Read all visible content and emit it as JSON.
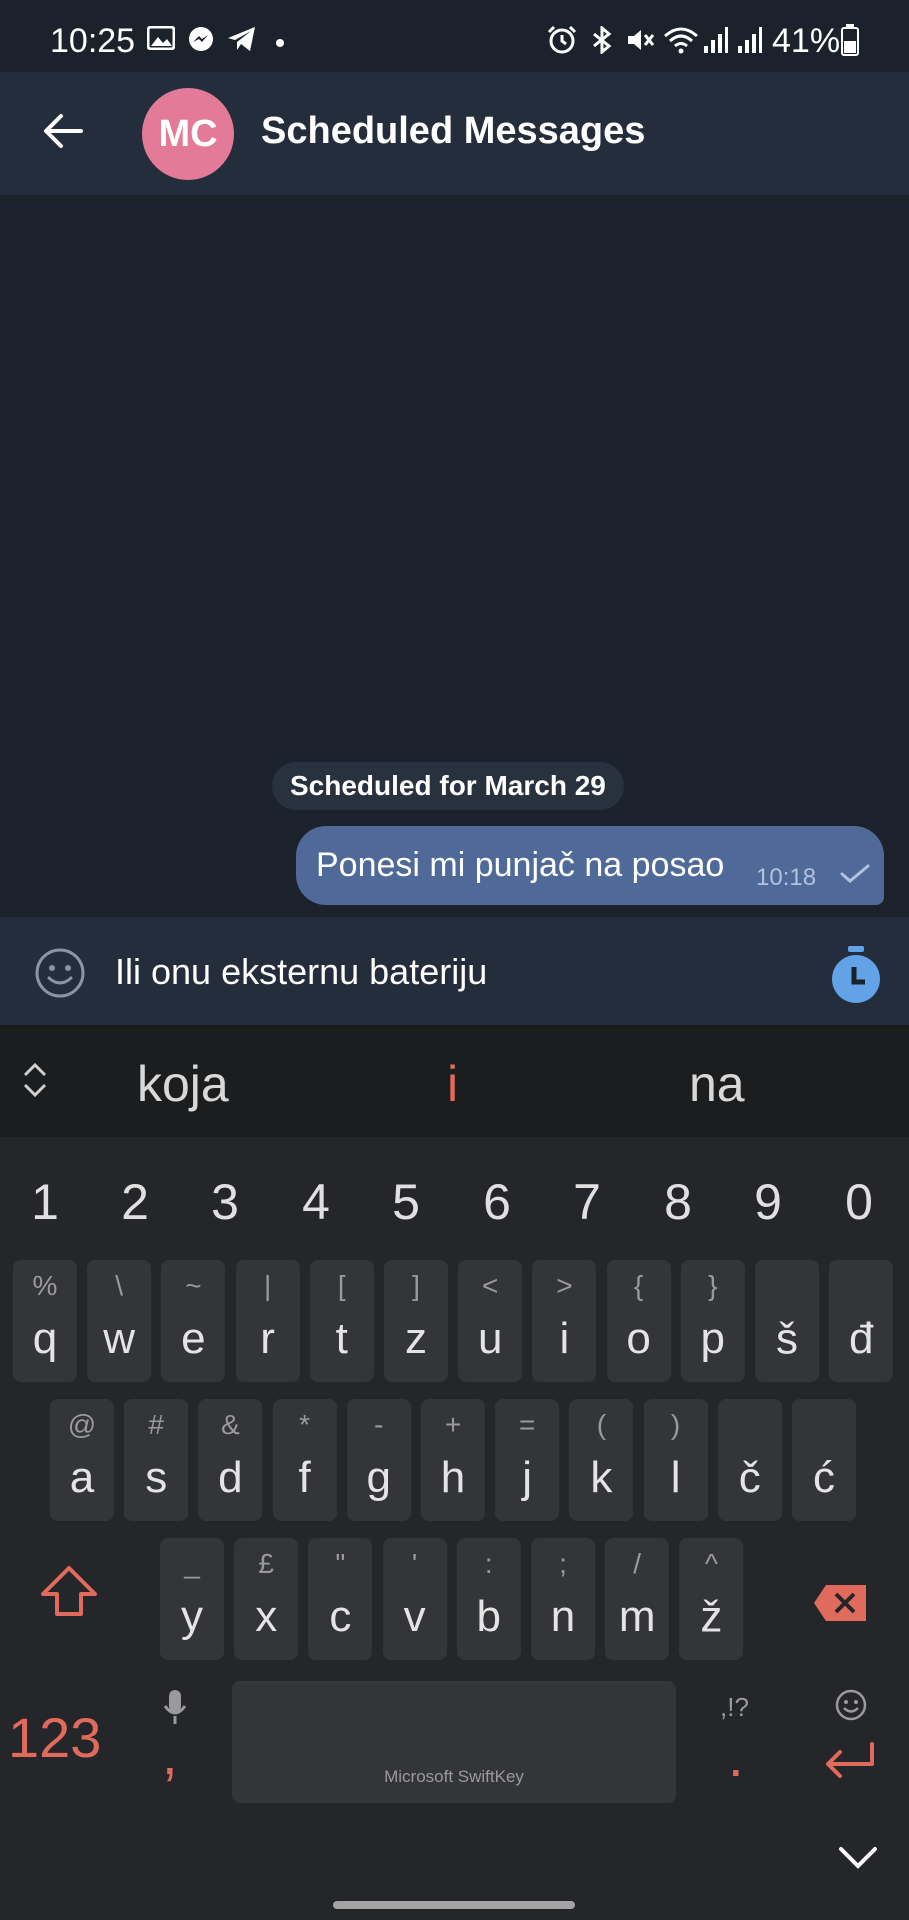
{
  "status_bar": {
    "time": "10:25",
    "battery": "41%",
    "icons": [
      "gallery-icon",
      "messenger-icon",
      "telegram-icon",
      "dot-icon",
      "alarm-icon",
      "bluetooth-icon",
      "mute-icon",
      "wifi-icon",
      "signal-icon",
      "signal-icon",
      "battery-icon"
    ]
  },
  "header": {
    "avatar_initials": "MC",
    "avatar_color": "#e27a98",
    "title": "Scheduled Messages"
  },
  "chat": {
    "date_chip": "Scheduled for March 29",
    "message": {
      "text": "Ponesi mi punjač na posao",
      "time": "10:18",
      "bubble_color": "#4f6a99"
    }
  },
  "input": {
    "value": "Ili onu eksternu bateriju"
  },
  "keyboard": {
    "suggestions": [
      "koja",
      "i",
      "na"
    ],
    "numbers": [
      "1",
      "2",
      "3",
      "4",
      "5",
      "6",
      "7",
      "8",
      "9",
      "0"
    ],
    "row1": [
      {
        "alt": "%",
        "main": "q"
      },
      {
        "alt": "\\",
        "main": "w"
      },
      {
        "alt": "~",
        "main": "e"
      },
      {
        "alt": "|",
        "main": "r"
      },
      {
        "alt": "[",
        "main": "t"
      },
      {
        "alt": "]",
        "main": "z"
      },
      {
        "alt": "<",
        "main": "u"
      },
      {
        "alt": ">",
        "main": "i"
      },
      {
        "alt": "{",
        "main": "o"
      },
      {
        "alt": "}",
        "main": "p"
      },
      {
        "alt": "",
        "main": "š"
      },
      {
        "alt": "",
        "main": "đ"
      }
    ],
    "row2": [
      {
        "alt": "@",
        "main": "a"
      },
      {
        "alt": "#",
        "main": "s"
      },
      {
        "alt": "&",
        "main": "d"
      },
      {
        "alt": "*",
        "main": "f"
      },
      {
        "alt": "-",
        "main": "g"
      },
      {
        "alt": "+",
        "main": "h"
      },
      {
        "alt": "=",
        "main": "j"
      },
      {
        "alt": "(",
        "main": "k"
      },
      {
        "alt": ")",
        "main": "l"
      },
      {
        "alt": "",
        "main": "č"
      },
      {
        "alt": "",
        "main": "ć"
      }
    ],
    "row3": [
      {
        "alt": "_",
        "main": "y"
      },
      {
        "alt": "£",
        "main": "x"
      },
      {
        "alt": "\"",
        "main": "c"
      },
      {
        "alt": "'",
        "main": "v"
      },
      {
        "alt": ":",
        "main": "b"
      },
      {
        "alt": ";",
        "main": "n"
      },
      {
        "alt": "/",
        "main": "m"
      },
      {
        "alt": "^",
        "main": "ž"
      }
    ],
    "numbers_key": "123",
    "comma": ",",
    "space_label": "Microsoft SwiftKey",
    "period": ".",
    "punct_alt": ",!?",
    "accent_color": "#e06a5b"
  }
}
